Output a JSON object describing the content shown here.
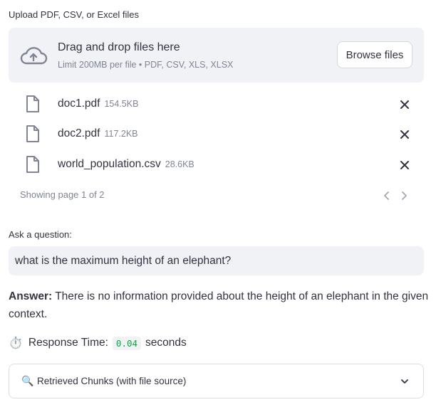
{
  "uploader": {
    "label": "Upload PDF, CSV, or Excel files",
    "dropzone_title": "Drag and drop files here",
    "dropzone_subtitle": "Limit 200MB per file • PDF, CSV, XLS, XLSX",
    "browse_label": "Browse files",
    "icons": [
      "cloud-upload-icon",
      "file-icon",
      "close-icon"
    ],
    "files": [
      {
        "name": "doc1.pdf",
        "size": "154.5KB"
      },
      {
        "name": "doc2.pdf",
        "size": "117.2KB"
      },
      {
        "name": "world_population.csv",
        "size": "28.6KB"
      }
    ],
    "pagination": "Showing page 1 of 2"
  },
  "question": {
    "label": "Ask a question:",
    "value": "what is the maximum height of an elephant?"
  },
  "answer": {
    "prefix": "Answer:",
    "text": "There is no information provided about the height of an elephant in the given context."
  },
  "response": {
    "icon": "⏱️",
    "label": "Response Time:",
    "value": "0.04",
    "unit": "seconds"
  },
  "expander": {
    "icon": "🔍",
    "label": "Retrieved Chunks (with file source)"
  },
  "colors": {
    "background": "#ffffff",
    "panel": "#f0f2f6",
    "text": "#31333f",
    "muted": "#808495",
    "code_green": "#09ab3b"
  }
}
